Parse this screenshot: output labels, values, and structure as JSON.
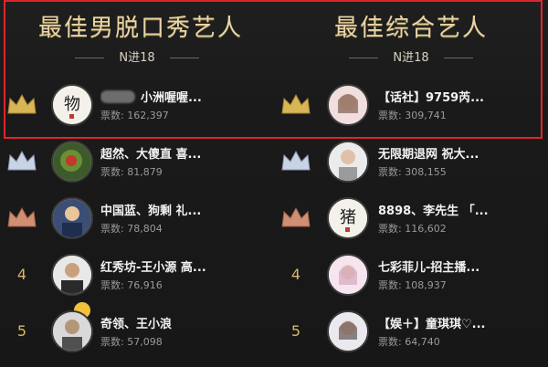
{
  "colors": {
    "title_gold": "#e9d5a5",
    "highlight_red": "#e0242b",
    "crown_gold": "#d9b655",
    "crown_silver": "#c9d3e6",
    "crown_bronze": "#d08f72",
    "rank_number": "#d6b86a"
  },
  "left_column": {
    "title": "最佳男脱口秀艺人",
    "subtitle": "N进18",
    "rows": [
      {
        "rank_display": "",
        "crown": "gold-crown-icon",
        "name": "小洲喔喔...",
        "votes_label": "票数:",
        "votes": "162,397",
        "avatar_icon": "calligraphy-avatar-icon",
        "blurred_prefix": true
      },
      {
        "rank_display": "",
        "crown": "silver-crown-icon",
        "name": "超然、大傻直 喜...",
        "votes_label": "票数:",
        "votes": "81,879",
        "avatar_icon": "green-avatar-icon"
      },
      {
        "rank_display": "",
        "crown": "bronze-crown-icon",
        "name": "中国蓝、狗剩 礼...",
        "votes_label": "票数:",
        "votes": "78,804",
        "avatar_icon": "cartoon-avatar-icon"
      },
      {
        "rank_display": "4",
        "crown": "",
        "name": "红秀坊-王小源 高...",
        "votes_label": "票数:",
        "votes": "76,916",
        "avatar_icon": "person-avatar-icon"
      },
      {
        "rank_display": "5",
        "crown": "",
        "name": "奇领、王小浪",
        "votes_label": "票数:",
        "votes": "57,098",
        "avatar_icon": "person-avatar-icon"
      }
    ]
  },
  "right_column": {
    "title": "最佳综合艺人",
    "subtitle": "N进18",
    "rows": [
      {
        "rank_display": "",
        "crown": "gold-crown-icon",
        "name": "【话社】9759芮...",
        "votes_label": "票数:",
        "votes": "309,741",
        "avatar_icon": "girl-avatar-icon"
      },
      {
        "rank_display": "",
        "crown": "silver-crown-icon",
        "name": "无限期退网 祝大...",
        "votes_label": "票数:",
        "votes": "308,155",
        "avatar_icon": "person-avatar-icon"
      },
      {
        "rank_display": "",
        "crown": "bronze-crown-icon",
        "name": "8898、李先生 「...",
        "votes_label": "票数:",
        "votes": "116,602",
        "avatar_icon": "calligraphy-avatar-icon"
      },
      {
        "rank_display": "4",
        "crown": "",
        "name": "七彩菲儿-招主播...",
        "votes_label": "票数:",
        "votes": "108,937",
        "avatar_icon": "girl-avatar-icon"
      },
      {
        "rank_display": "5",
        "crown": "",
        "name": "【娱＋】童琪琪♡...",
        "votes_label": "票数:",
        "votes": "64,740",
        "avatar_icon": "girl-avatar-icon"
      }
    ]
  }
}
